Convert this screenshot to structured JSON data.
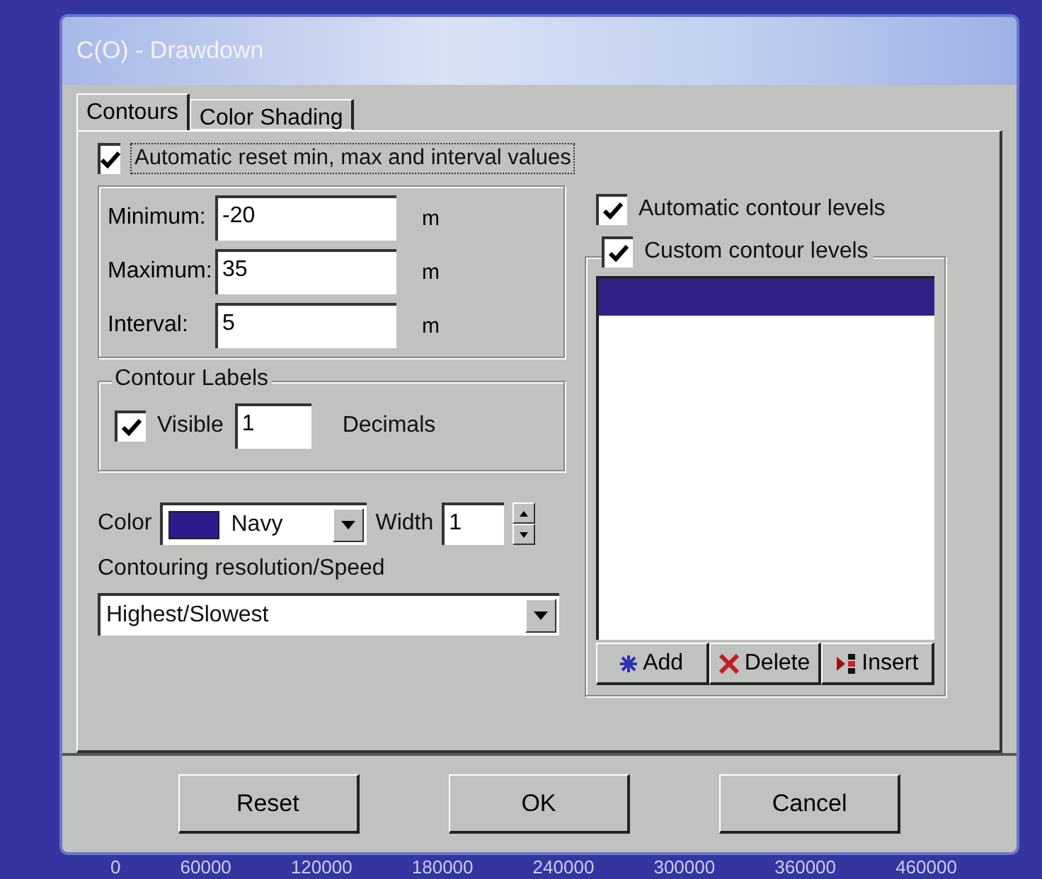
{
  "window": {
    "title": "C(O) - Drawdown"
  },
  "tabs": [
    {
      "label": "Contours",
      "selected": true
    },
    {
      "label": "Color Shading",
      "selected": false
    }
  ],
  "auto_reset": {
    "label": "Automatic reset min, max and interval values",
    "checked": true
  },
  "range_fields": [
    {
      "label": "Minimum:",
      "value": "-20",
      "unit": "m"
    },
    {
      "label": "Maximum:",
      "value": "35",
      "unit": "m"
    },
    {
      "label": "Interval:",
      "value": "5",
      "unit": "m"
    }
  ],
  "contour_labels": {
    "title": "Contour Labels",
    "visible_label": "Visible",
    "visible": true,
    "decimals_value": "1",
    "decimals_label": "Decimals"
  },
  "line_color": {
    "label": "Color",
    "value": "Navy",
    "color": "#2e1a8c"
  },
  "line_width": {
    "label": "Width",
    "value": "1"
  },
  "resolution": {
    "label": "Contouring resolution/Speed",
    "value": "Highest/Slowest"
  },
  "auto_levels": {
    "label": "Automatic contour levels",
    "checked": true
  },
  "custom_levels": {
    "label": "Custom contour levels",
    "checked": true,
    "rows": [
      {
        "selected": true
      }
    ]
  },
  "level_buttons": [
    {
      "kind": "add",
      "label": "Add"
    },
    {
      "kind": "delete",
      "label": "Delete"
    },
    {
      "kind": "insert",
      "label": "Insert"
    }
  ],
  "buttons": [
    "Reset",
    "OK",
    "Cancel"
  ],
  "background_axis": [
    "0",
    "60000",
    "120000",
    "180000",
    "240000",
    "300000",
    "360000",
    "460000"
  ]
}
